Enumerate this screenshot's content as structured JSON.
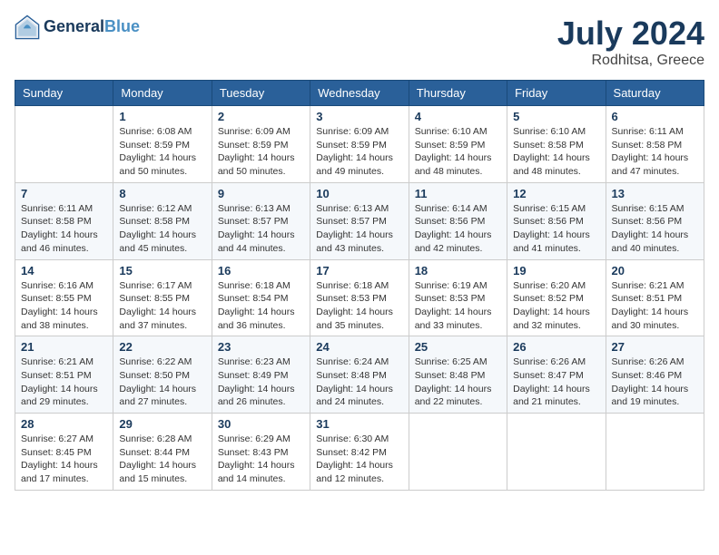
{
  "header": {
    "logo_line1": "General",
    "logo_line2": "Blue",
    "month_title": "July 2024",
    "location": "Rodhitsa, Greece"
  },
  "weekdays": [
    "Sunday",
    "Monday",
    "Tuesday",
    "Wednesday",
    "Thursday",
    "Friday",
    "Saturday"
  ],
  "weeks": [
    [
      {
        "day": "",
        "info": ""
      },
      {
        "day": "1",
        "info": "Sunrise: 6:08 AM\nSunset: 8:59 PM\nDaylight: 14 hours\nand 50 minutes."
      },
      {
        "day": "2",
        "info": "Sunrise: 6:09 AM\nSunset: 8:59 PM\nDaylight: 14 hours\nand 50 minutes."
      },
      {
        "day": "3",
        "info": "Sunrise: 6:09 AM\nSunset: 8:59 PM\nDaylight: 14 hours\nand 49 minutes."
      },
      {
        "day": "4",
        "info": "Sunrise: 6:10 AM\nSunset: 8:59 PM\nDaylight: 14 hours\nand 48 minutes."
      },
      {
        "day": "5",
        "info": "Sunrise: 6:10 AM\nSunset: 8:58 PM\nDaylight: 14 hours\nand 48 minutes."
      },
      {
        "day": "6",
        "info": "Sunrise: 6:11 AM\nSunset: 8:58 PM\nDaylight: 14 hours\nand 47 minutes."
      }
    ],
    [
      {
        "day": "7",
        "info": "Sunrise: 6:11 AM\nSunset: 8:58 PM\nDaylight: 14 hours\nand 46 minutes."
      },
      {
        "day": "8",
        "info": "Sunrise: 6:12 AM\nSunset: 8:58 PM\nDaylight: 14 hours\nand 45 minutes."
      },
      {
        "day": "9",
        "info": "Sunrise: 6:13 AM\nSunset: 8:57 PM\nDaylight: 14 hours\nand 44 minutes."
      },
      {
        "day": "10",
        "info": "Sunrise: 6:13 AM\nSunset: 8:57 PM\nDaylight: 14 hours\nand 43 minutes."
      },
      {
        "day": "11",
        "info": "Sunrise: 6:14 AM\nSunset: 8:56 PM\nDaylight: 14 hours\nand 42 minutes."
      },
      {
        "day": "12",
        "info": "Sunrise: 6:15 AM\nSunset: 8:56 PM\nDaylight: 14 hours\nand 41 minutes."
      },
      {
        "day": "13",
        "info": "Sunrise: 6:15 AM\nSunset: 8:56 PM\nDaylight: 14 hours\nand 40 minutes."
      }
    ],
    [
      {
        "day": "14",
        "info": "Sunrise: 6:16 AM\nSunset: 8:55 PM\nDaylight: 14 hours\nand 38 minutes."
      },
      {
        "day": "15",
        "info": "Sunrise: 6:17 AM\nSunset: 8:55 PM\nDaylight: 14 hours\nand 37 minutes."
      },
      {
        "day": "16",
        "info": "Sunrise: 6:18 AM\nSunset: 8:54 PM\nDaylight: 14 hours\nand 36 minutes."
      },
      {
        "day": "17",
        "info": "Sunrise: 6:18 AM\nSunset: 8:53 PM\nDaylight: 14 hours\nand 35 minutes."
      },
      {
        "day": "18",
        "info": "Sunrise: 6:19 AM\nSunset: 8:53 PM\nDaylight: 14 hours\nand 33 minutes."
      },
      {
        "day": "19",
        "info": "Sunrise: 6:20 AM\nSunset: 8:52 PM\nDaylight: 14 hours\nand 32 minutes."
      },
      {
        "day": "20",
        "info": "Sunrise: 6:21 AM\nSunset: 8:51 PM\nDaylight: 14 hours\nand 30 minutes."
      }
    ],
    [
      {
        "day": "21",
        "info": "Sunrise: 6:21 AM\nSunset: 8:51 PM\nDaylight: 14 hours\nand 29 minutes."
      },
      {
        "day": "22",
        "info": "Sunrise: 6:22 AM\nSunset: 8:50 PM\nDaylight: 14 hours\nand 27 minutes."
      },
      {
        "day": "23",
        "info": "Sunrise: 6:23 AM\nSunset: 8:49 PM\nDaylight: 14 hours\nand 26 minutes."
      },
      {
        "day": "24",
        "info": "Sunrise: 6:24 AM\nSunset: 8:48 PM\nDaylight: 14 hours\nand 24 minutes."
      },
      {
        "day": "25",
        "info": "Sunrise: 6:25 AM\nSunset: 8:48 PM\nDaylight: 14 hours\nand 22 minutes."
      },
      {
        "day": "26",
        "info": "Sunrise: 6:26 AM\nSunset: 8:47 PM\nDaylight: 14 hours\nand 21 minutes."
      },
      {
        "day": "27",
        "info": "Sunrise: 6:26 AM\nSunset: 8:46 PM\nDaylight: 14 hours\nand 19 minutes."
      }
    ],
    [
      {
        "day": "28",
        "info": "Sunrise: 6:27 AM\nSunset: 8:45 PM\nDaylight: 14 hours\nand 17 minutes."
      },
      {
        "day": "29",
        "info": "Sunrise: 6:28 AM\nSunset: 8:44 PM\nDaylight: 14 hours\nand 15 minutes."
      },
      {
        "day": "30",
        "info": "Sunrise: 6:29 AM\nSunset: 8:43 PM\nDaylight: 14 hours\nand 14 minutes."
      },
      {
        "day": "31",
        "info": "Sunrise: 6:30 AM\nSunset: 8:42 PM\nDaylight: 14 hours\nand 12 minutes."
      },
      {
        "day": "",
        "info": ""
      },
      {
        "day": "",
        "info": ""
      },
      {
        "day": "",
        "info": ""
      }
    ]
  ]
}
